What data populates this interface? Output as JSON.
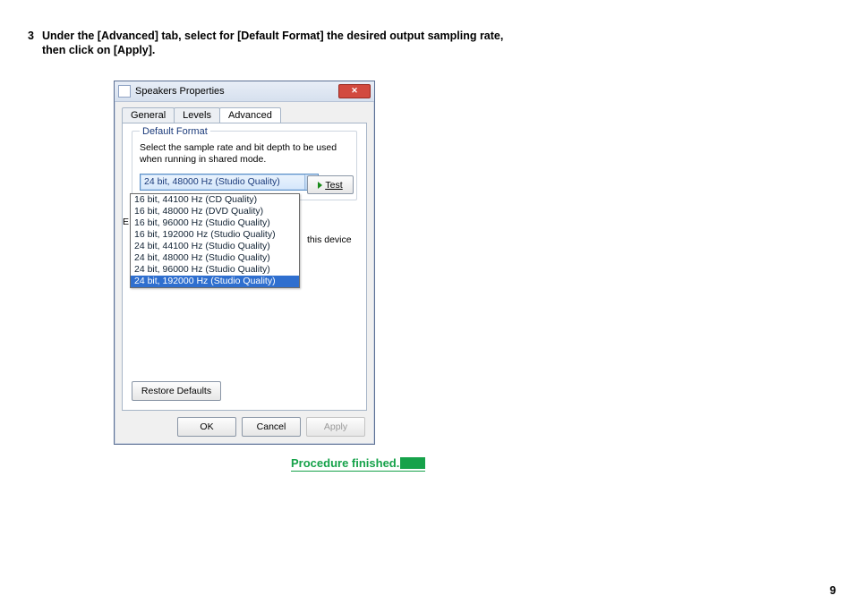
{
  "step_number": "3",
  "step_instruction": "Under the [Advanced] tab, select for [Default Format] the desired output sampling rate, then click on [Apply].",
  "dialog": {
    "title": "Speakers Properties",
    "tabs": [
      "General",
      "Levels",
      "Advanced"
    ],
    "active_tab": "Advanced",
    "group_title": "Default Format",
    "group_desc": "Select the sample rate and bit depth to be used when running in shared mode.",
    "combo_selected": "24 bit, 48000 Hz (Studio Quality)",
    "test_label": "Test",
    "dropdown_options": [
      "16 bit, 44100 Hz (CD Quality)",
      "16 bit, 48000 Hz (DVD Quality)",
      "16 bit, 96000 Hz (Studio Quality)",
      "16 bit, 192000 Hz (Studio Quality)",
      "24 bit, 44100 Hz (Studio Quality)",
      "24 bit, 48000 Hz (Studio Quality)",
      "24 bit, 96000 Hz (Studio Quality)",
      "24 bit, 192000 Hz (Studio Quality)"
    ],
    "selected_option": "24 bit, 192000 Hz (Studio Quality)",
    "errata_mark": "E",
    "peek_text": "this device",
    "restore_label": "Restore Defaults",
    "ok_label": "OK",
    "cancel_label": "Cancel",
    "apply_label": "Apply"
  },
  "finished_text": "Procedure finished.",
  "page_number": "9"
}
